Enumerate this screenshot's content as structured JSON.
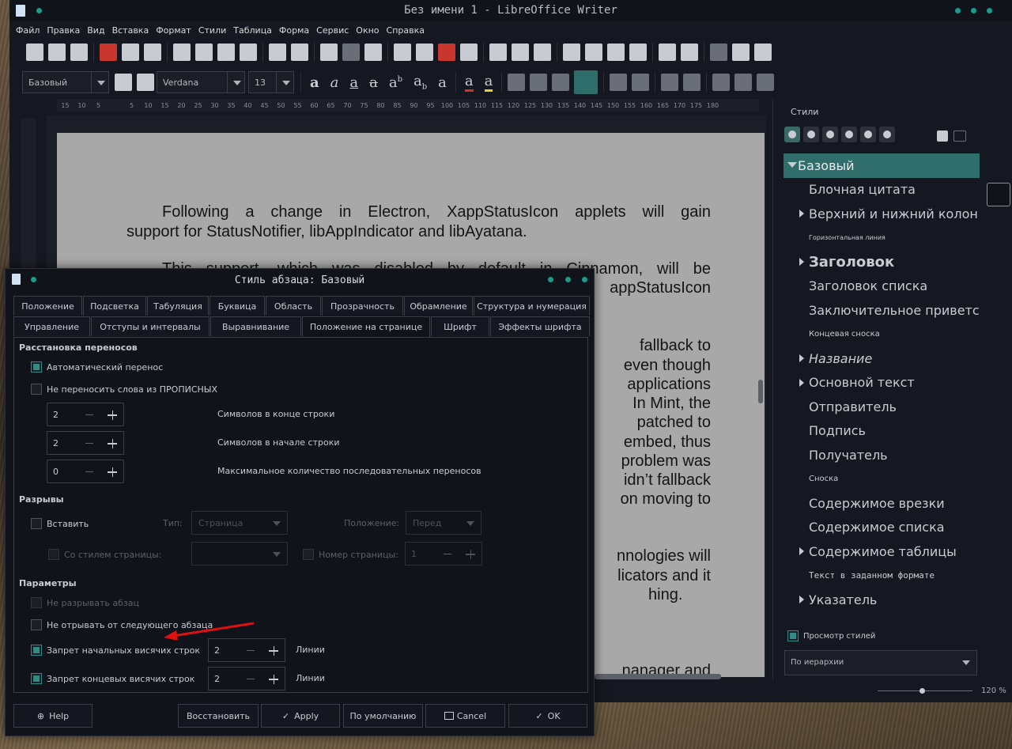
{
  "window": {
    "title": "Без имени 1 - LibreOffice Writer"
  },
  "menu": [
    "Файл",
    "Правка",
    "Вид",
    "Вставка",
    "Формат",
    "Стили",
    "Таблица",
    "Форма",
    "Сервис",
    "Окно",
    "Справка"
  ],
  "formatbar": {
    "para_style": "Базовый",
    "font": "Verdana",
    "size": "13"
  },
  "ruler": [
    "15",
    "10",
    "5",
    "",
    "5",
    "10",
    "15",
    "20",
    "25",
    "30",
    "35",
    "40",
    "45",
    "50",
    "55",
    "60",
    "65",
    "70",
    "75",
    "80",
    "85",
    "90",
    "95",
    "100",
    "105",
    "110",
    "115",
    "120",
    "125",
    "130",
    "135",
    "140",
    "145",
    "150",
    "155",
    "160",
    "165",
    "170",
    "175",
    "180"
  ],
  "document": {
    "p1a": "Following a change in Electron, XappStatusIcon applets will gain",
    "p1b": "support for StatusNotifier, libAppIndicator and libAyatana.",
    "p2a": "This support, which was disabled by default in Cinnamon, will be",
    "p2b": "appStatusIcon",
    "r1": "fallback to",
    "r2": "even though",
    "r3": "applications",
    "r4": "In Mint, the",
    "r5": "patched to",
    "r6": "embed, thus",
    "r7": "problem was",
    "r8": "idn’t fallback",
    "r9": "on moving to",
    "r10": "nnologies will",
    "r11": "licators and it",
    "r12": "hing.",
    "r13": "nanager and"
  },
  "sidebar": {
    "title": "Стили",
    "styles": [
      {
        "label": "Базовый"
      },
      {
        "label": "Блочная цитата"
      },
      {
        "label": "Верхний и нижний колон"
      },
      {
        "label": "Горизонтальная линия"
      },
      {
        "label": "Заголовок"
      },
      {
        "label": "Заголовок списка"
      },
      {
        "label": "Заключительное приветс"
      },
      {
        "label": "Концевая сноска"
      },
      {
        "label": "Название"
      },
      {
        "label": "Основной текст"
      },
      {
        "label": "Отправитель"
      },
      {
        "label": "Подпись"
      },
      {
        "label": "Получатель"
      },
      {
        "label": "Сноска"
      },
      {
        "label": "Содержимое врезки"
      },
      {
        "label": "Содержимое списка"
      },
      {
        "label": "Содержимое таблицы"
      },
      {
        "label": "Текст в заданном формате"
      },
      {
        "label": "Указатель"
      }
    ],
    "preview_label": "Просмотр стилей",
    "filter": "По иерархии"
  },
  "status": {
    "zoom": "120 %"
  },
  "dialog": {
    "title": "Стиль абзаца: Базовый",
    "tabs_row1": [
      "Положение",
      "Подсветка",
      "Табуляция",
      "Буквица",
      "Область",
      "Прозрачность",
      "Обрамление",
      "Структура и нумерация"
    ],
    "tabs_row2": [
      "Управление",
      "Отступы и интервалы",
      "Выравнивание",
      "Положение на странице",
      "Шрифт",
      "Эффекты шрифта"
    ],
    "hyph": {
      "section": "Расстановка переносов",
      "auto": "Автоматический перенос",
      "caps": "Не переносить слова из ПРОПИСНЫХ",
      "end_val": "2",
      "end_label": "Символов в конце строки",
      "start_val": "2",
      "start_label": "Символов в начале строки",
      "max_val": "0",
      "max_label": "Максимальное количество последовательных переносов"
    },
    "breaks": {
      "section": "Разрывы",
      "insert": "Вставить",
      "type_label": "Тип:",
      "type_val": "Страница",
      "pos_label": "Положение:",
      "pos_val": "Перед",
      "with_style": "Со стилем страницы:",
      "page_num": "Номер страницы:",
      "page_num_val": "1"
    },
    "params": {
      "section": "Параметры",
      "no_split": "Не разрывать абзац",
      "keep_next": "Не отрывать от следующего абзаца",
      "orphan": "Запрет начальных висячих строк",
      "orphan_val": "2",
      "orphan_unit": "Линии",
      "widow": "Запрет концевых висячих строк",
      "widow_val": "2",
      "widow_unit": "Линии"
    },
    "buttons": {
      "help": "Help",
      "reset": "Восстановить",
      "apply": "Apply",
      "default": "По умолчанию",
      "cancel": "Cancel",
      "ok": "OK"
    }
  }
}
